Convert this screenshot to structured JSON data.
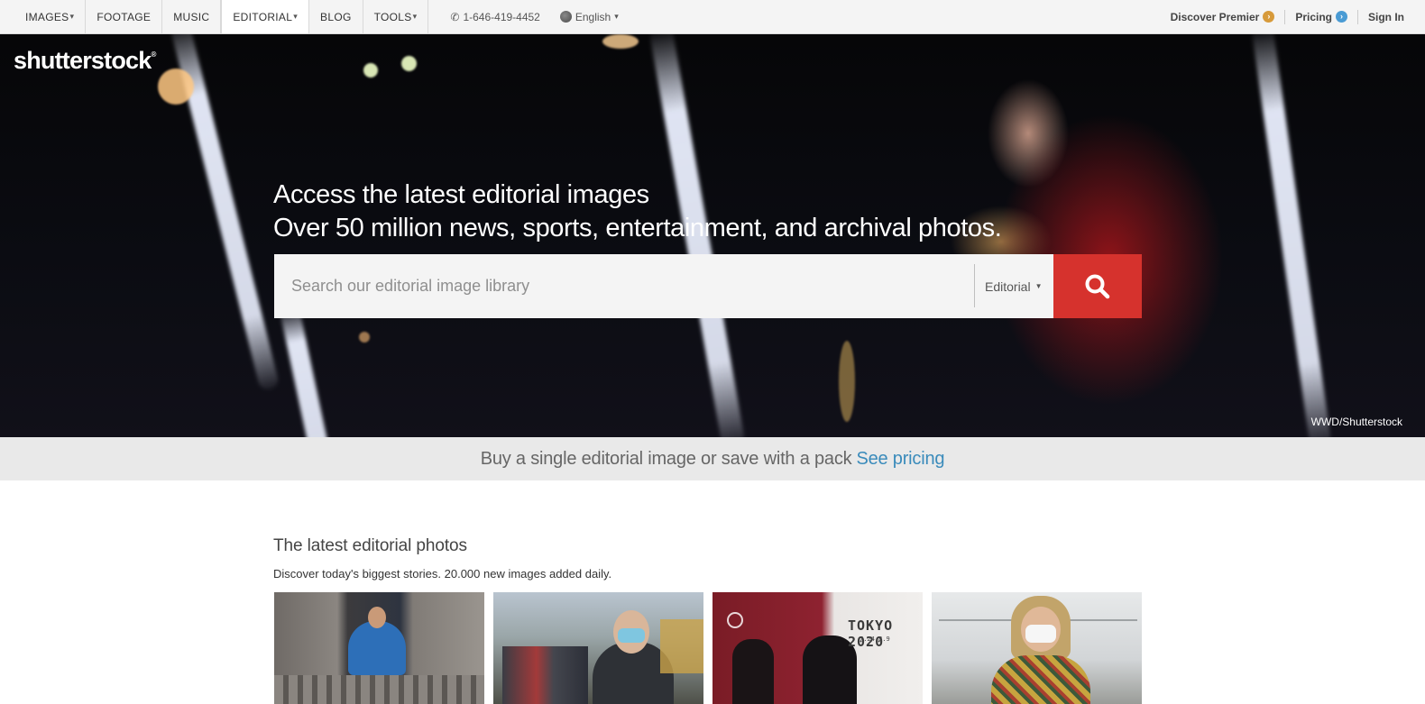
{
  "nav": {
    "items": [
      {
        "label": "IMAGES",
        "has_caret": true
      },
      {
        "label": "FOOTAGE",
        "has_caret": false
      },
      {
        "label": "MUSIC",
        "has_caret": false
      },
      {
        "label": "EDITORIAL",
        "has_caret": true,
        "active": true
      },
      {
        "label": "BLOG",
        "has_caret": false
      },
      {
        "label": "TOOLS",
        "has_caret": true
      }
    ],
    "caret": "▾",
    "phone": "1-646-419-4452",
    "language": "English",
    "right": {
      "premier": "Discover Premier",
      "pricing": "Pricing",
      "signin": "Sign In"
    }
  },
  "hero": {
    "logo": "shutterstock",
    "title": "Access the latest editorial images",
    "subtitle": "Over 50 million news, sports, entertainment, and archival photos.",
    "search_placeholder": "Search our editorial image library",
    "scope": "Editorial",
    "credit": "WWD/Shutterstock"
  },
  "strip": {
    "text": "Buy a single editorial image or save with a pack",
    "link": "See pricing"
  },
  "latest": {
    "title": "The latest editorial photos",
    "subtitle": "Discover today's biggest stories. 20.000 new images added daily.",
    "thumbs": [
      {
        "name": "thumb-man-on-balcony",
        "caption": ""
      },
      {
        "name": "thumb-masked-crowd",
        "caption": ""
      },
      {
        "name": "thumb-tokyo-2020",
        "caption": "TOKYO 2020",
        "caption2": "7.24 8.9"
      },
      {
        "name": "thumb-masked-woman",
        "caption": ""
      }
    ]
  },
  "colors": {
    "accent_red": "#d6322d",
    "link_blue": "#3a8bbb",
    "premier_orange": "#d79a3a",
    "pricing_blue": "#4a9bd4"
  },
  "icons": [
    "phone-icon",
    "globe-icon",
    "arrow-right-icon",
    "search-icon",
    "caret-down-icon"
  ]
}
